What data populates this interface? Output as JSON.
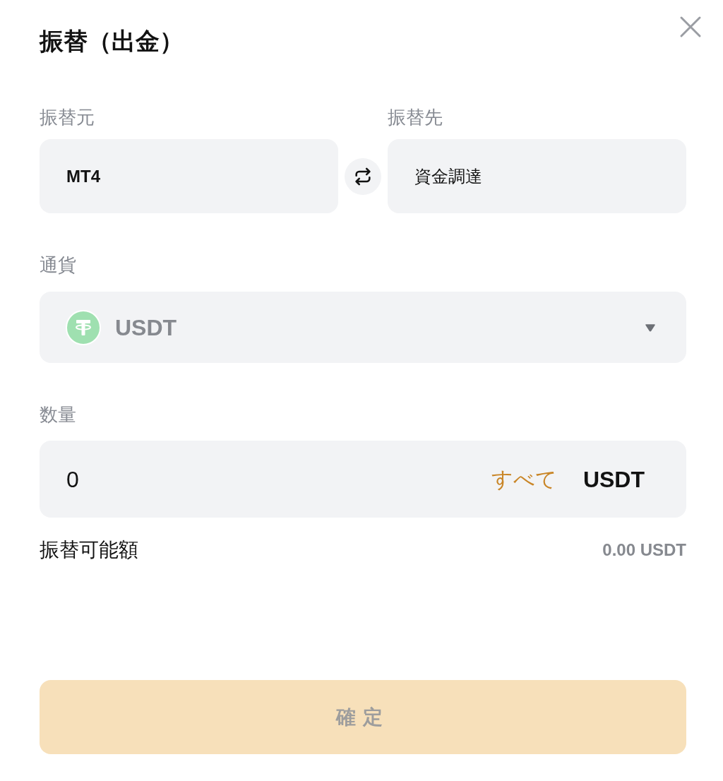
{
  "dialog": {
    "title": "振替（出金）"
  },
  "transfer": {
    "from": {
      "label": "振替元",
      "value": "MT4"
    },
    "to": {
      "label": "振替先",
      "value": "資金調達"
    }
  },
  "currency": {
    "label": "通貨",
    "value": "USDT"
  },
  "amount": {
    "label": "数量",
    "value": "0",
    "max_link": "すべて",
    "unit": "USDT"
  },
  "available": {
    "label": "振替可能額",
    "value": "0.00 USDT"
  },
  "confirm": {
    "label": "確定",
    "disabled": true
  }
}
